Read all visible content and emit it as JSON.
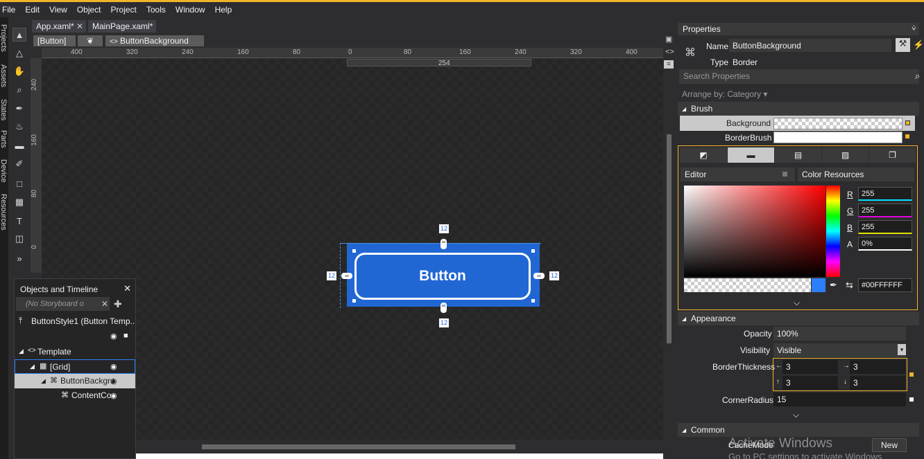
{
  "menu": [
    "File",
    "Edit",
    "View",
    "Object",
    "Project",
    "Tools",
    "Window",
    "Help"
  ],
  "left_dock_tabs": [
    "Projects",
    "Assets",
    "States",
    "Parts",
    "Device",
    "Resources"
  ],
  "doc_tabs": [
    {
      "label": "App.xaml*"
    },
    {
      "label": "MainPage.xaml*"
    }
  ],
  "breadcrumb": {
    "first": "[Button]",
    "last": "ButtonBackground"
  },
  "ruler_h": [
    "400",
    "320",
    "240",
    "160",
    "80",
    "0",
    "80",
    "160",
    "240",
    "320",
    "400"
  ],
  "ruler_v": [
    "240",
    "160",
    "80",
    "0"
  ],
  "ruler_width_label": "254",
  "artboard": {
    "button_label": "Button",
    "margin_top": "12",
    "margin_left": "12",
    "margin_right": "12",
    "margin_bottom": "12"
  },
  "objects_timeline": {
    "title": "Objects and Timeline",
    "storyboard": "(No Storyboard o",
    "style_row": "ButtonStyle1 (Button Temp...",
    "template_label": "Template",
    "tree": [
      {
        "label": "[Grid]"
      },
      {
        "label": "ButtonBackgro"
      },
      {
        "label": "ContentCo"
      }
    ]
  },
  "properties": {
    "title": "Properties",
    "name_label": "Name",
    "name_value": "ButtonBackground",
    "type_label": "Type",
    "type_value": "Border",
    "search_placeholder": "Search Properties",
    "arrange_by": "Arrange by: Category",
    "brush_section": "Brush",
    "background_label": "Background",
    "borderbrush_label": "BorderBrush",
    "editor_tab": "Editor",
    "color_resources_tab": "Color Resources",
    "r_label": "R",
    "r_value": "255",
    "g_label": "G",
    "g_value": "255",
    "b_label": "B",
    "b_value": "255",
    "a_label": "A",
    "a_value": "0%",
    "hex_value": "#00FFFFFF",
    "appearance_section": "Appearance",
    "opacity_label": "Opacity",
    "opacity_value": "100%",
    "visibility_label": "Visibility",
    "visibility_value": "Visible",
    "borderthickness_label": "BorderThickness",
    "bt_left": "3",
    "bt_right": "3",
    "bt_top": "3",
    "bt_bottom": "3",
    "cornerradius_label": "CornerRadius",
    "cornerradius_value": "15",
    "common_section": "Common",
    "cachemode_label": "CacheMode",
    "new_button": "New"
  },
  "watermark": {
    "line1": "Activate Windows",
    "line2": "Go to PC settings to activate Windows"
  },
  "colors": {
    "accent": "#f0b429",
    "button_fill": "#2167d4",
    "highlight": "#2d7ff9"
  }
}
